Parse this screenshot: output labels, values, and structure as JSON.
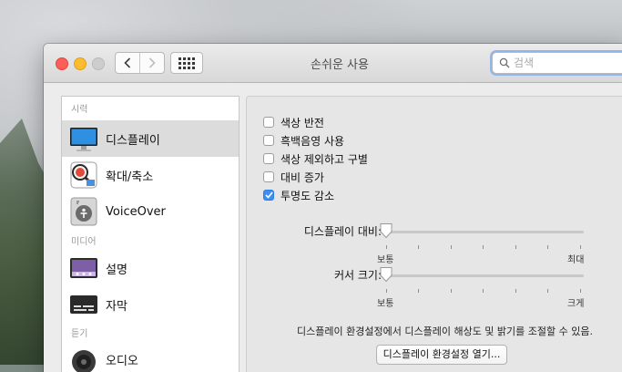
{
  "window": {
    "title": "손쉬운 사용"
  },
  "search": {
    "placeholder": "검색",
    "value": ""
  },
  "sidebar": {
    "sections": [
      {
        "label": "시력"
      },
      {
        "label": "미디어"
      },
      {
        "label": "듣기"
      }
    ],
    "items": [
      {
        "label": "디스플레이",
        "icon": "display-icon",
        "selected": true
      },
      {
        "label": "확대/축소",
        "icon": "zoom-icon"
      },
      {
        "label": "VoiceOver",
        "icon": "voiceover-icon"
      },
      {
        "label": "설명",
        "icon": "descriptions-icon"
      },
      {
        "label": "자막",
        "icon": "captions-icon"
      },
      {
        "label": "오디오",
        "icon": "audio-speaker-icon"
      }
    ]
  },
  "pane": {
    "checkboxes": [
      {
        "label": "색상 반전",
        "checked": false
      },
      {
        "label": "흑백음영 사용",
        "checked": false
      },
      {
        "label": "색상 제외하고 구별",
        "checked": false
      },
      {
        "label": "대비 증가",
        "checked": false
      },
      {
        "label": "투명도 감소",
        "checked": true
      }
    ],
    "sliders": [
      {
        "label": "디스플레이 대비:",
        "min_label": "보통",
        "max_label": "최대",
        "value": 0
      },
      {
        "label": "커서 크기:",
        "min_label": "보통",
        "max_label": "크게",
        "value": 0
      }
    ],
    "note": "디스플레이 환경설정에서 디스플레이 해상도 및 밝기를 조절할 수 있음.",
    "open_button": "디스플레이 환경설정 열기..."
  },
  "colors": {
    "accent": "#3a8ef6",
    "close": "#fc5f57",
    "minimize": "#fdbc2e"
  }
}
